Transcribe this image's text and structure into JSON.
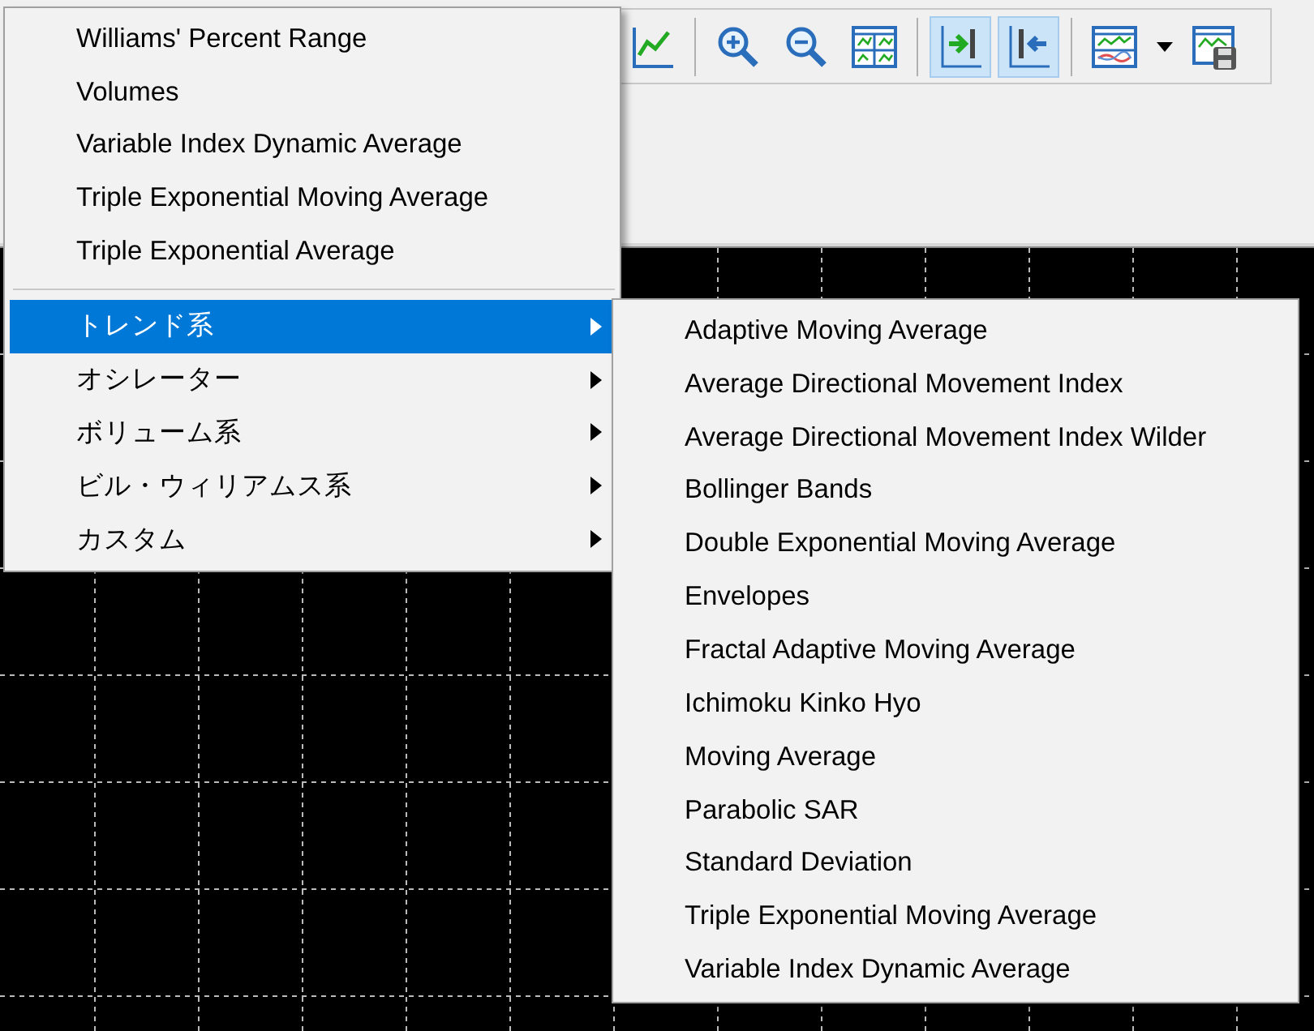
{
  "toolbar": {
    "buttons": [
      {
        "kind": "line-chart",
        "selected": false
      },
      {
        "kind": "separator"
      },
      {
        "kind": "zoom-in",
        "selected": false
      },
      {
        "kind": "zoom-out",
        "selected": false
      },
      {
        "kind": "tile",
        "selected": false
      },
      {
        "kind": "separator"
      },
      {
        "kind": "auto-scroll",
        "selected": true
      },
      {
        "kind": "chart-shift",
        "selected": true
      },
      {
        "kind": "separator"
      },
      {
        "kind": "indicators",
        "selected": false
      },
      {
        "kind": "dropdown"
      },
      {
        "kind": "template",
        "selected": false
      }
    ]
  },
  "indicator_menu": {
    "items": [
      {
        "label": "Williams' Percent Range"
      },
      {
        "label": "Volumes"
      },
      {
        "label": "Variable Index Dynamic Average"
      },
      {
        "label": "Triple Exponential Moving Average"
      },
      {
        "label": "Triple Exponential Average"
      }
    ],
    "categories": [
      {
        "label": "トレンド系",
        "selected": true
      },
      {
        "label": "オシレーター",
        "selected": false
      },
      {
        "label": "ボリューム系",
        "selected": false
      },
      {
        "label": "ビル・ウィリアムス系",
        "selected": false
      },
      {
        "label": "カスタム",
        "selected": false
      }
    ]
  },
  "submenu": {
    "items": [
      {
        "label": "Adaptive Moving Average"
      },
      {
        "label": "Average Directional Movement Index"
      },
      {
        "label": "Average Directional Movement Index Wilder"
      },
      {
        "label": "Bollinger Bands"
      },
      {
        "label": "Double Exponential Moving Average"
      },
      {
        "label": "Envelopes"
      },
      {
        "label": "Fractal Adaptive Moving Average"
      },
      {
        "label": "Ichimoku Kinko Hyo"
      },
      {
        "label": "Moving Average"
      },
      {
        "label": "Parabolic SAR"
      },
      {
        "label": "Standard Deviation"
      },
      {
        "label": "Triple Exponential Moving Average"
      },
      {
        "label": "Variable Index Dynamic Average"
      }
    ]
  }
}
